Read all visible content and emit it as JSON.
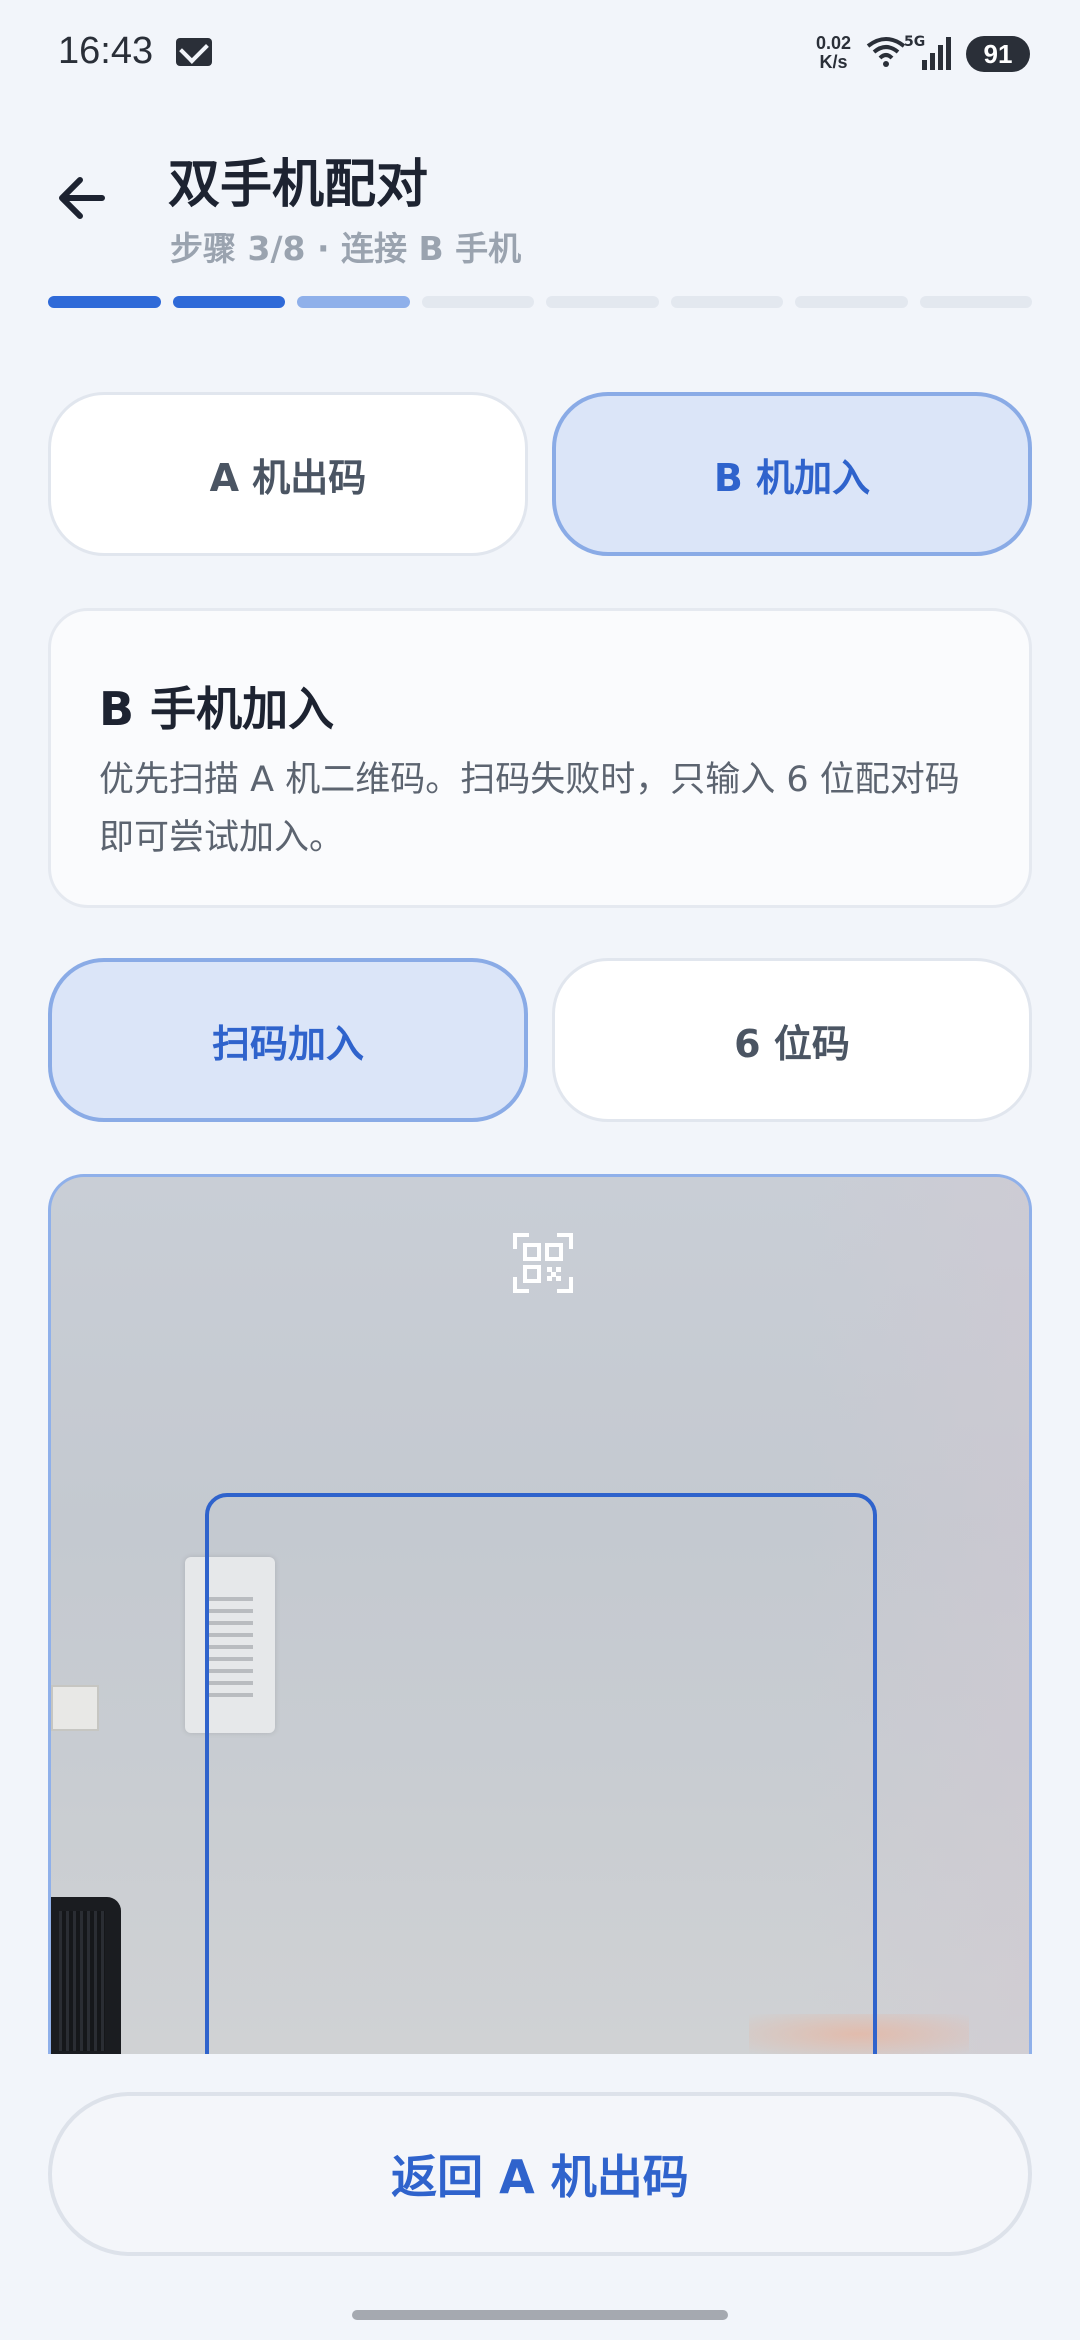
{
  "status_bar": {
    "time": "16:43",
    "speed_value": "0.02",
    "speed_unit": "K/s",
    "network": "5G",
    "battery": "91"
  },
  "header": {
    "title": "双手机配对",
    "subtitle": "步骤 3/8 · 连接 B 手机",
    "progress": {
      "total_steps": 8,
      "current_step": 3
    }
  },
  "role_tabs": {
    "a_label": "A 机出码",
    "b_label": "B 机加入",
    "selected": "b"
  },
  "info_card": {
    "title": "B 手机加入",
    "description": "优先扫描 A 机二维码。扫码失败时，只输入 6 位配对码即可尝试加入。"
  },
  "mode_tabs": {
    "scan_label": "扫码加入",
    "code_label": "6 位码",
    "selected": "scan"
  },
  "camera": {
    "scan_icon": "qr-scan-icon"
  },
  "footer": {
    "back_label": "返回 A 机出码"
  },
  "colors": {
    "accent": "#2f63cc",
    "accent_light": "#dbe5f8",
    "background": "#f2f5fa"
  }
}
